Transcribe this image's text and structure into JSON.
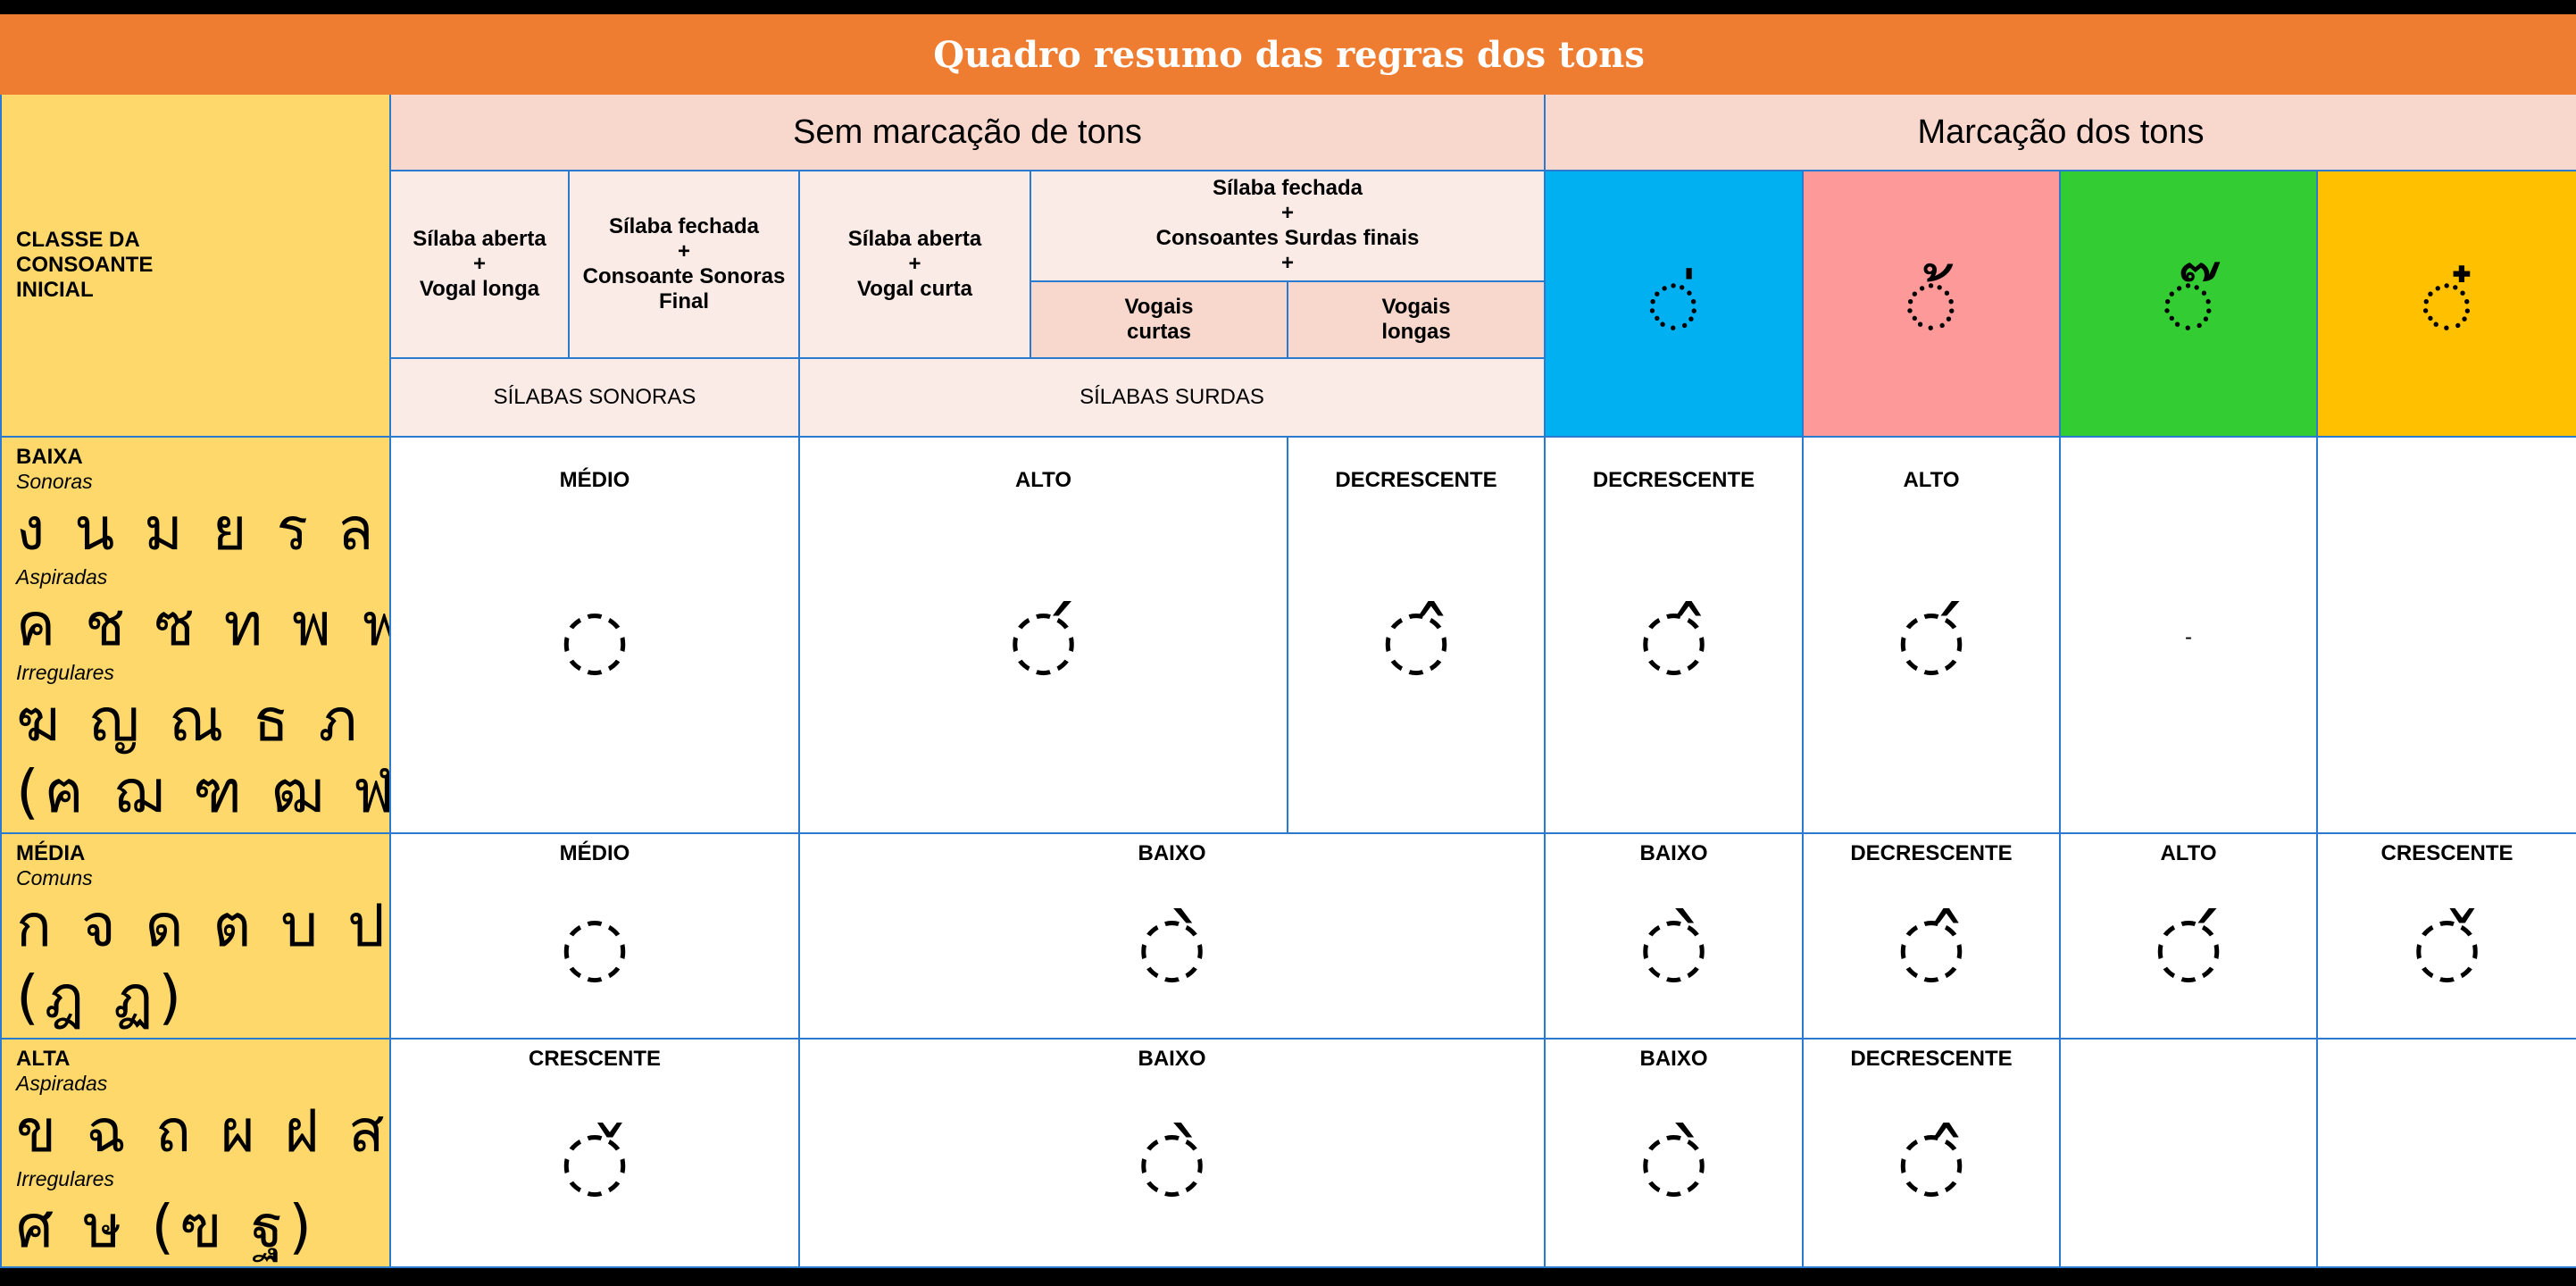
{
  "title": "Quadro resumo das regras dos tons",
  "header": {
    "unmarked": "Sem marcação de tons",
    "marked": "Marcação dos tons",
    "class_label": [
      "CLASSE DA",
      "CONSOANTE",
      "INICIAL"
    ],
    "col1": [
      "Sílaba aberta",
      "+",
      "Vogal longa"
    ],
    "col2": [
      "Sílaba fechada",
      "+",
      "Consoante Sonoras",
      "Final"
    ],
    "col3": [
      "Sílaba aberta",
      "+",
      "Vogal curta"
    ],
    "col4": [
      "Sílaba fechada",
      "+",
      "Consoantes Surdas finais",
      "+"
    ],
    "col4a": [
      "Vogais",
      "curtas"
    ],
    "col4b": [
      "Vogais",
      "longas"
    ],
    "sonoras": "SÍLABAS SONORAS",
    "surdas": "SÍLABAS SURDAS",
    "marks": [
      "◌่",
      "◌้",
      "◌๊",
      "◌๋"
    ]
  },
  "rows": {
    "baixa": {
      "name": "BAIXA",
      "sub1": "Sonoras",
      "thai1": "ง น ม ย ร ล ว",
      "sub2": "Aspiradas",
      "thai2": "ค ช ซ ท พ ฟ ฮ",
      "sub3": "Irregulares",
      "thai3": "ฆ ญ ณ ธ ภ",
      "thai4": "(ฅ ฌ ฑ ฒ ฬ)",
      "tones": [
        "MÉDIO",
        "ALTO",
        "DECRESCENTE",
        "DECRESCENTE",
        "ALTO",
        "",
        ""
      ],
      "symbols": [
        "◌",
        "◌́",
        "◌̂",
        "◌̂",
        "◌́",
        "-",
        ""
      ]
    },
    "media": {
      "name": "MÉDIA",
      "sub1": "Comuns",
      "thai1": "ก จ ด ต บ ป อ",
      "thai2": "(ฎ ฏ)",
      "tones": [
        "MÉDIO",
        "BAIXO",
        "BAIXO",
        "DECRESCENTE",
        "ALTO",
        "CRESCENTE"
      ],
      "symbols": [
        "◌",
        "◌̀",
        "◌̀",
        "◌̂",
        "◌́",
        "◌̌"
      ]
    },
    "alta": {
      "name": "ALTA",
      "sub1": "Aspiradas",
      "thai1": "ข ฉ ถ ผ ฝ ส ห",
      "sub2": "Irregulares",
      "thai2": "ศ ษ (ฃ ฐ)",
      "tones": [
        "CRESCENTE",
        "BAIXO",
        "BAIXO",
        "DECRESCENTE",
        "",
        ""
      ],
      "symbols": [
        "◌̌",
        "◌̀",
        "◌̀",
        "◌̂",
        "",
        ""
      ]
    }
  },
  "colors": {
    "title": "#ee7c31",
    "class": "#fed86b",
    "mai_ek": "#00b0f0",
    "mai_tho": "#fe9999",
    "mai_tri": "#33cc33",
    "mai_chattawa": "#ffc000",
    "grid": "#2a7bd0"
  }
}
